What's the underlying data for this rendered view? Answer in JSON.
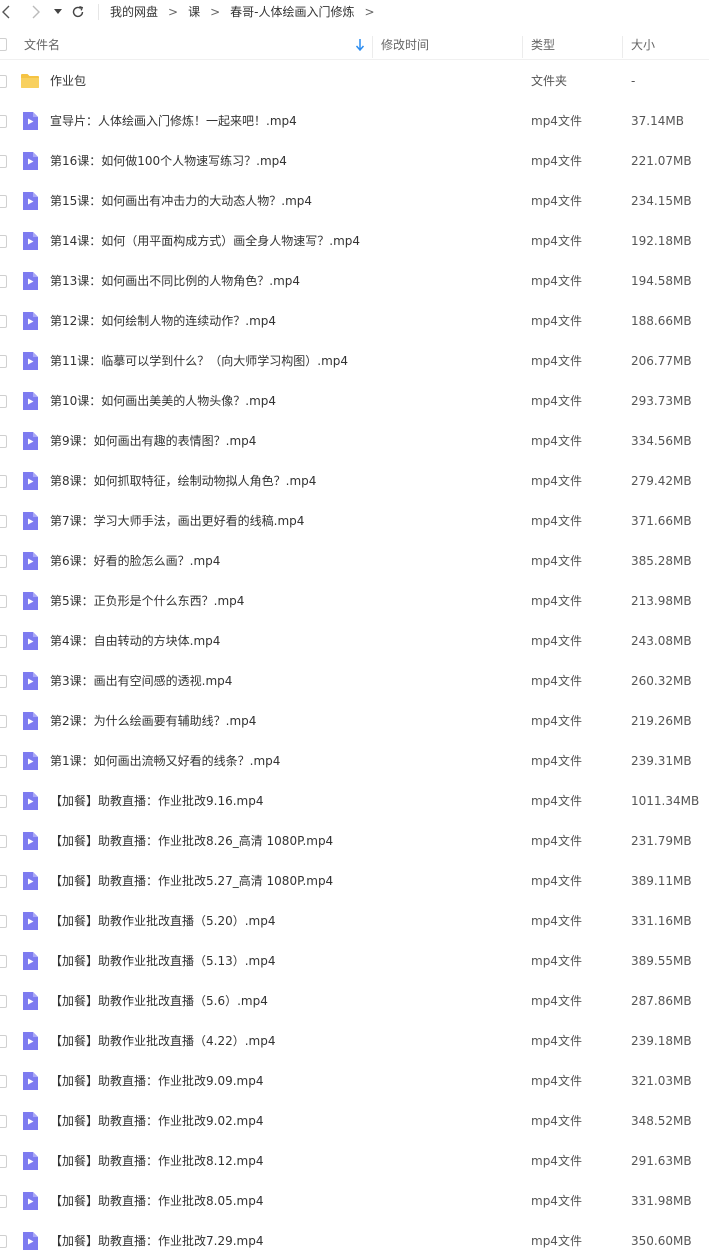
{
  "nav": {
    "back_icon": "chevron-left-icon",
    "forward_icon": "chevron-right-icon",
    "dropdown_icon": "caret-down-icon",
    "refresh_icon": "refresh-icon"
  },
  "breadcrumb": [
    "我的网盘",
    "课",
    "春哥-人体绘画入门修炼"
  ],
  "breadcrumb_separator": ">",
  "columns": {
    "name": "文件名",
    "modified": "修改时间",
    "type": "类型",
    "size": "大小"
  },
  "colors": {
    "folder": "#f5c343",
    "video": "#7d7bf0",
    "sort_arrow": "#2b8cf0"
  },
  "files": [
    {
      "name": "作业包",
      "type": "文件夹",
      "size": "-",
      "icon": "folder"
    },
    {
      "name": "宣导片：人体绘画入门修炼！一起来吧！.mp4",
      "type": "mp4文件",
      "size": "37.14MB",
      "icon": "video"
    },
    {
      "name": "第16课：如何做100个人物速写练习？.mp4",
      "type": "mp4文件",
      "size": "221.07MB",
      "icon": "video"
    },
    {
      "name": "第15课：如何画出有冲击力的大动态人物？.mp4",
      "type": "mp4文件",
      "size": "234.15MB",
      "icon": "video"
    },
    {
      "name": "第14课：如何（用平面构成方式）画全身人物速写？.mp4",
      "type": "mp4文件",
      "size": "192.18MB",
      "icon": "video"
    },
    {
      "name": "第13课：如何画出不同比例的人物角色？.mp4",
      "type": "mp4文件",
      "size": "194.58MB",
      "icon": "video"
    },
    {
      "name": "第12课：如何绘制人物的连续动作？.mp4",
      "type": "mp4文件",
      "size": "188.66MB",
      "icon": "video"
    },
    {
      "name": "第11课：临摹可以学到什么？（向大师学习构图）.mp4",
      "type": "mp4文件",
      "size": "206.77MB",
      "icon": "video"
    },
    {
      "name": "第10课：如何画出美美的人物头像？.mp4",
      "type": "mp4文件",
      "size": "293.73MB",
      "icon": "video"
    },
    {
      "name": "第9课：如何画出有趣的表情图？.mp4",
      "type": "mp4文件",
      "size": "334.56MB",
      "icon": "video"
    },
    {
      "name": "第8课：如何抓取特征，绘制动物拟人角色？.mp4",
      "type": "mp4文件",
      "size": "279.42MB",
      "icon": "video"
    },
    {
      "name": "第7课：学习大师手法，画出更好看的线稿.mp4",
      "type": "mp4文件",
      "size": "371.66MB",
      "icon": "video"
    },
    {
      "name": "第6课：好看的脸怎么画？.mp4",
      "type": "mp4文件",
      "size": "385.28MB",
      "icon": "video"
    },
    {
      "name": "第5课：正负形是个什么东西？.mp4",
      "type": "mp4文件",
      "size": "213.98MB",
      "icon": "video"
    },
    {
      "name": "第4课：自由转动的方块体.mp4",
      "type": "mp4文件",
      "size": "243.08MB",
      "icon": "video"
    },
    {
      "name": "第3课：画出有空间感的透视.mp4",
      "type": "mp4文件",
      "size": "260.32MB",
      "icon": "video"
    },
    {
      "name": "第2课：为什么绘画要有辅助线？.mp4",
      "type": "mp4文件",
      "size": "219.26MB",
      "icon": "video"
    },
    {
      "name": "第1课：如何画出流畅又好看的线条？.mp4",
      "type": "mp4文件",
      "size": "239.31MB",
      "icon": "video"
    },
    {
      "name": "【加餐】助教直播：作业批改9.16.mp4",
      "type": "mp4文件",
      "size": "1011.34MB",
      "icon": "video"
    },
    {
      "name": "【加餐】助教直播：作业批改8.26_高清 1080P.mp4",
      "type": "mp4文件",
      "size": "231.79MB",
      "icon": "video"
    },
    {
      "name": "【加餐】助教直播：作业批改5.27_高清 1080P.mp4",
      "type": "mp4文件",
      "size": "389.11MB",
      "icon": "video"
    },
    {
      "name": "【加餐】助教作业批改直播（5.20）.mp4",
      "type": "mp4文件",
      "size": "331.16MB",
      "icon": "video"
    },
    {
      "name": "【加餐】助教作业批改直播（5.13）.mp4",
      "type": "mp4文件",
      "size": "389.55MB",
      "icon": "video"
    },
    {
      "name": "【加餐】助教作业批改直播（5.6）.mp4",
      "type": "mp4文件",
      "size": "287.86MB",
      "icon": "video"
    },
    {
      "name": "【加餐】助教作业批改直播（4.22）.mp4",
      "type": "mp4文件",
      "size": "239.18MB",
      "icon": "video"
    },
    {
      "name": "【加餐】助教直播：作业批改9.09.mp4",
      "type": "mp4文件",
      "size": "321.03MB",
      "icon": "video"
    },
    {
      "name": "【加餐】助教直播：作业批改9.02.mp4",
      "type": "mp4文件",
      "size": "348.52MB",
      "icon": "video"
    },
    {
      "name": "【加餐】助教直播：作业批改8.12.mp4",
      "type": "mp4文件",
      "size": "291.63MB",
      "icon": "video"
    },
    {
      "name": "【加餐】助教直播：作业批改8.05.mp4",
      "type": "mp4文件",
      "size": "331.98MB",
      "icon": "video"
    },
    {
      "name": "【加餐】助教直播：作业批改7.29.mp4",
      "type": "mp4文件",
      "size": "350.60MB",
      "icon": "video"
    }
  ]
}
